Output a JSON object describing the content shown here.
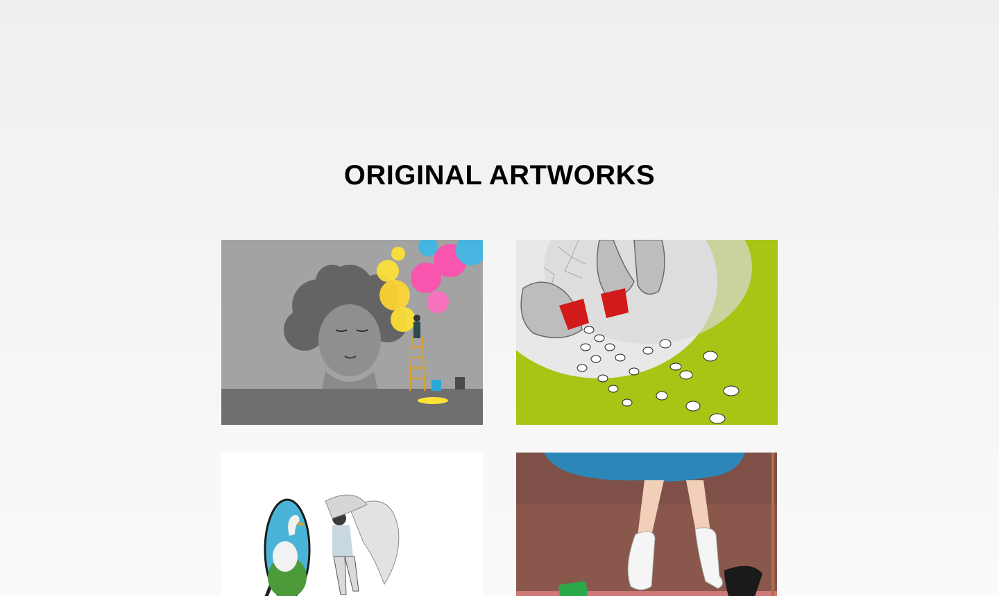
{
  "section": {
    "title": "ORIGINAL ARTWORKS"
  },
  "artworks": [
    {
      "subject": "grayscale woman's face with colorful smoke and a painter on a ladder"
    },
    {
      "subject": "giant hands pouring sheep from red containers onto a lime-green field"
    },
    {
      "subject": "winged figure leaning on a round mirror showing a swan"
    },
    {
      "subject": "legs in a blue skirt and slouch socks stepping out of a black heel"
    }
  ],
  "colors": {
    "title": "#000000",
    "background_top": "#efefef",
    "background_bottom": "#fafafa"
  }
}
